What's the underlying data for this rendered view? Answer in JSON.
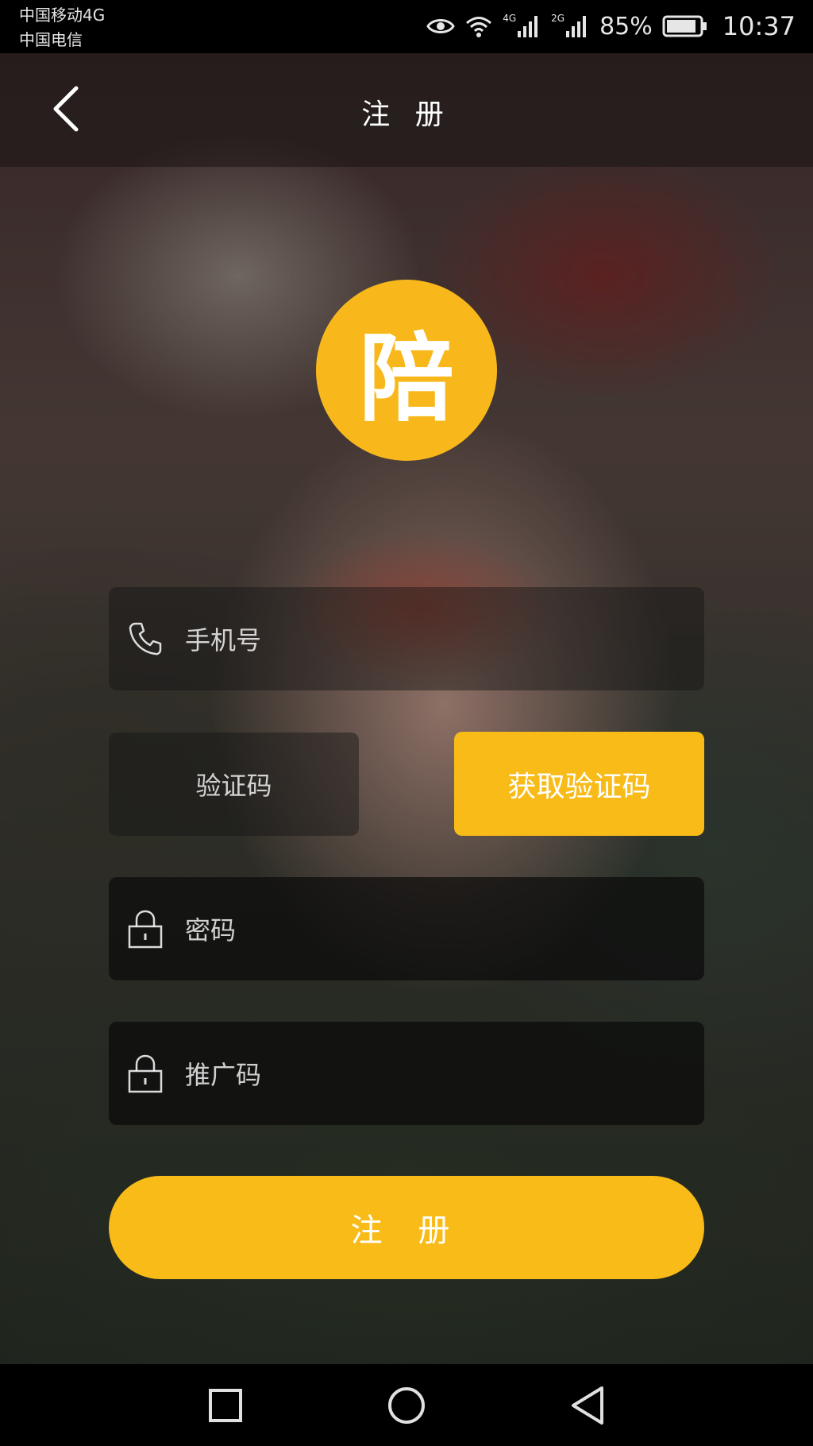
{
  "status_bar": {
    "carrier_1": "中国移动4G",
    "carrier_2": "中国电信",
    "net_1": "4G",
    "net_2": "2G",
    "battery": "85%",
    "time": "10:37"
  },
  "header": {
    "title": "注 册"
  },
  "logo": {
    "char": "陪"
  },
  "form": {
    "phone_placeholder": "手机号",
    "code_placeholder": "验证码",
    "get_code_label": "获取验证码",
    "password_placeholder": "密码",
    "promo_placeholder": "推广码"
  },
  "actions": {
    "register_label": "注 册"
  },
  "colors": {
    "accent": "#f8bb18",
    "statusbar_bg": "#000000",
    "text": "#ffffff"
  },
  "icons": [
    "back-arrow-icon",
    "phone-icon",
    "lock-icon",
    "eye-icon",
    "wifi-icon",
    "signal-icon",
    "battery-icon",
    "square-icon",
    "circle-icon",
    "triangle-back-icon"
  ]
}
